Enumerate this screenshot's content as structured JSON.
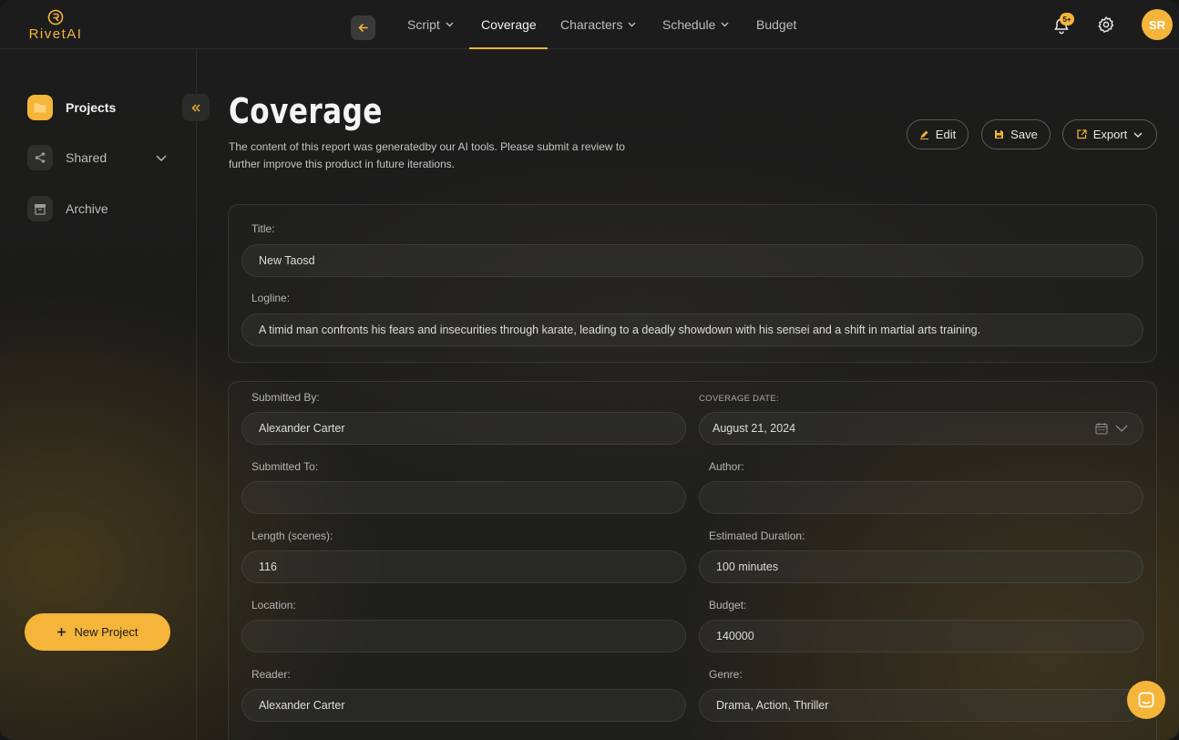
{
  "brand": {
    "name": "RivetAI"
  },
  "nav": {
    "items": [
      {
        "label": "Script",
        "dropdown": true
      },
      {
        "label": "Coverage",
        "dropdown": false,
        "active": true
      },
      {
        "label": "Characters",
        "dropdown": true
      },
      {
        "label": "Schedule",
        "dropdown": true
      },
      {
        "label": "Budget",
        "dropdown": false
      }
    ],
    "notification_badge": "5+",
    "user_initials": "SR"
  },
  "sidebar": {
    "items": [
      {
        "label": "Projects",
        "icon": "folder-icon",
        "active": true
      },
      {
        "label": "Shared",
        "icon": "share-icon"
      },
      {
        "label": "Archive",
        "icon": "archive-icon"
      }
    ],
    "new_project_label": "New Project"
  },
  "page": {
    "title": "Coverage",
    "description": "The content of this report was generatedby our AI tools. Please submit a review to further improve this product in future iterations.",
    "actions": {
      "edit": "Edit",
      "save": "Save",
      "export": "Export"
    }
  },
  "summary": {
    "title_label": "Title:",
    "title_value": "New Taosd",
    "logline_label": "Logline:",
    "logline_value": "A timid man confronts his fears and insecurities through karate, leading to a deadly showdown with his sensei and a shift in martial arts training."
  },
  "details": {
    "submitted_by_label": "Submitted By:",
    "submitted_by_value": "Alexander Carter",
    "coverage_date_label": "COVERAGE DATE:",
    "coverage_date_value": "August 21, 2024",
    "submitted_to_label": "Submitted To:",
    "submitted_to_value": "",
    "author_label": "Author:",
    "author_value": "",
    "length_label": "Length (scenes):",
    "length_value": "116",
    "duration_label": "Estimated Duration:",
    "duration_value": "100 minutes",
    "location_label": "Location:",
    "location_value": "",
    "budget_label": "Budget:",
    "budget_value": "140000",
    "reader_label": "Reader:",
    "reader_value": "Alexander Carter",
    "genre_label": "Genre:",
    "genre_value": "Drama, Action, Thriller"
  },
  "colors": {
    "accent": "#f5b53b",
    "background": "#1a1a18"
  }
}
